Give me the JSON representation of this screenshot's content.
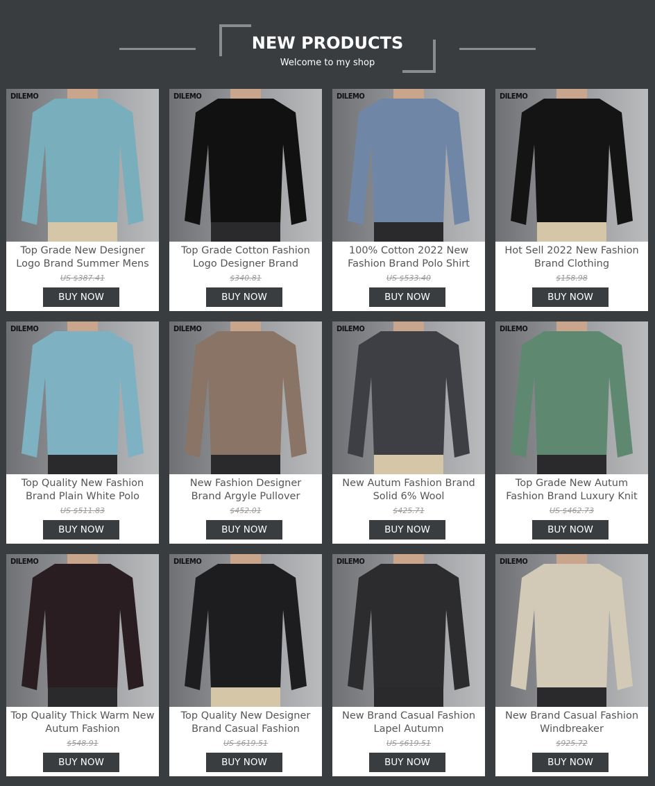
{
  "header": {
    "title": "NEW PRODUCTS",
    "subtitle": "Welcome to my shop"
  },
  "products": [
    {
      "brand": "DILEMO",
      "name": "Top Grade New Designer Logo Brand Summer Mens",
      "price": "US $387.41",
      "button": "BUY NOW",
      "icon": "polo-shirt-photo"
    },
    {
      "brand": "DILEMO",
      "name": "Top Grade Cotton Fashion Logo Designer Brand",
      "price": "$340.81",
      "button": "BUY NOW",
      "icon": "polo-shirt-photo"
    },
    {
      "brand": "DILEMO",
      "name": "100% Cotton 2022 New Fashion Brand Polo Shirt",
      "price": "US $533.40",
      "button": "BUY NOW",
      "icon": "polo-shirt-photo"
    },
    {
      "brand": "DILEMO",
      "name": "Hot Sell 2022 New Fashion Brand Clothing",
      "price": "$158.98",
      "button": "BUY NOW",
      "icon": "henley-shirt-photo"
    },
    {
      "brand": "DILEMO",
      "name": "Top Quality New Fashion Brand Plain White Polo",
      "price": "US $511.83",
      "button": "BUY NOW",
      "icon": "polo-shirt-photo"
    },
    {
      "brand": "DILEMO",
      "name": "New Fashion Designer Brand Argyle Pullover",
      "price": "$452.01",
      "button": "BUY NOW",
      "icon": "argyle-vest-photo"
    },
    {
      "brand": "DILEMO",
      "name": "New Autum Fashion Brand Solid 6% Wool",
      "price": "$425.71",
      "button": "BUY NOW",
      "icon": "wool-vest-photo"
    },
    {
      "brand": "DILEMO",
      "name": "Top Grade New Autum Fashion Brand Luxury Knit",
      "price": "US $462.73",
      "button": "BUY NOW",
      "icon": "knit-sweater-photo"
    },
    {
      "brand": "DILEMO",
      "name": "Top Quality Thick Warm New Autum Fashion",
      "price": "$548.91",
      "button": "BUY NOW",
      "icon": "striped-sweater-photo"
    },
    {
      "brand": "DILEMO",
      "name": "Top Quality New Designer Brand Casual Fashion",
      "price": "US $619.51",
      "button": "BUY NOW",
      "icon": "blazer-photo"
    },
    {
      "brand": "DILEMO",
      "name": "New Brand Casual Fashion Lapel Autumn",
      "price": "US $619.51",
      "button": "BUY NOW",
      "icon": "jacket-photo"
    },
    {
      "brand": "DILEMO",
      "name": "New Brand Casual Fashion Windbreaker",
      "price": "$925.72",
      "button": "BUY NOW",
      "icon": "puffer-vest-photo"
    }
  ],
  "colors": {
    "background": "#3a3d40",
    "card": "#ffffff",
    "button": "#3a3d40",
    "garments": [
      "#79aebd",
      "#111111",
      "#6f86a6",
      "#141414",
      "#7eb2c2",
      "#8a7466",
      "#3e3f44",
      "#5f8870",
      "#2a1d22",
      "#1d1d1f",
      "#2c2c2e",
      "#d2c9b7"
    ]
  }
}
